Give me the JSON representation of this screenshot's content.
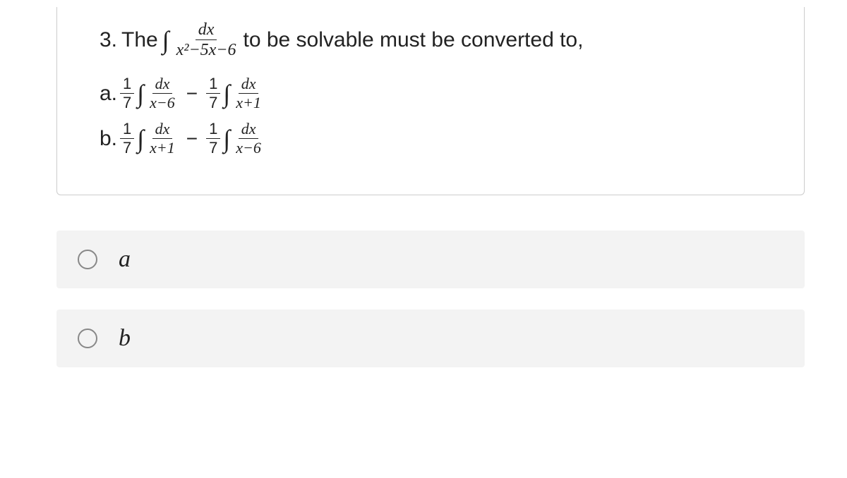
{
  "question": {
    "number": "3.",
    "prefix": "The",
    "integral_sym": "∫",
    "main_frac_num": "dx",
    "main_frac_den": "x²−5x−6",
    "suffix": "to be solvable must be converted to,"
  },
  "option_a": {
    "label": "a.",
    "coef1_num": "1",
    "coef1_den": "7",
    "int1": "∫",
    "frac1_num": "dx",
    "frac1_den": "x−6",
    "minus": "−",
    "coef2_num": "1",
    "coef2_den": "7",
    "int2": "∫",
    "frac2_num": "dx",
    "frac2_den": "x+1"
  },
  "option_b": {
    "label": "b.",
    "coef1_num": "1",
    "coef1_den": "7",
    "int1": "∫",
    "frac1_num": "dx",
    "frac1_den": "x+1",
    "minus": "−",
    "coef2_num": "1",
    "coef2_den": "7",
    "int2": "∫",
    "frac2_num": "dx",
    "frac2_den": "x−6"
  },
  "answers": {
    "a": "a",
    "b": "b"
  }
}
